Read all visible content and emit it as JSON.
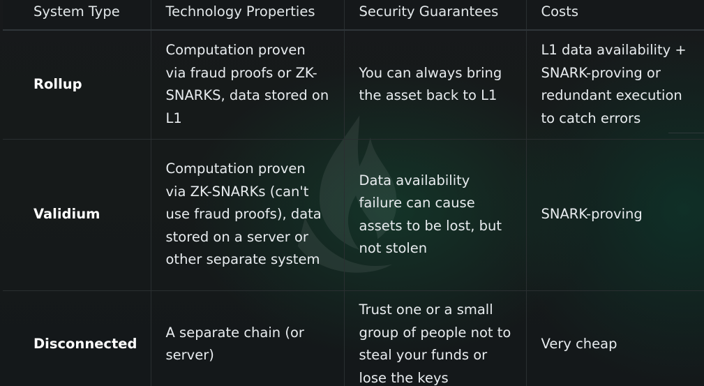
{
  "table": {
    "headers": [
      "System Type",
      "Technology Properties",
      "Security Guarantees",
      "Costs"
    ],
    "rows": [
      {
        "system_type": "Rollup",
        "technology": "Computation proven via fraud proofs or ZK-SNARKS, data stored on L1",
        "security": "You can always bring the asset back to L1",
        "costs": "L1 data availability + SNARK-proving or redundant execution to catch errors"
      },
      {
        "system_type": "Validium",
        "technology": "Computation proven via ZK-SNARKs (can't use fraud proofs), data stored on a server or other separate system",
        "security": "Data availability failure can cause assets to be lost, but not stolen",
        "costs": "SNARK-proving"
      },
      {
        "system_type": "Disconnected",
        "technology": "A separate chain (or server)",
        "security": "Trust one or a small group of people not to steal your funds or lose the keys",
        "costs": "Very cheap"
      }
    ]
  },
  "theme": {
    "background": "#171a1c",
    "accent_glow": "#124a34",
    "text": "#e8ecef",
    "border": "#2a2f31"
  },
  "icons": {
    "watermark": "flame-logo-icon"
  }
}
